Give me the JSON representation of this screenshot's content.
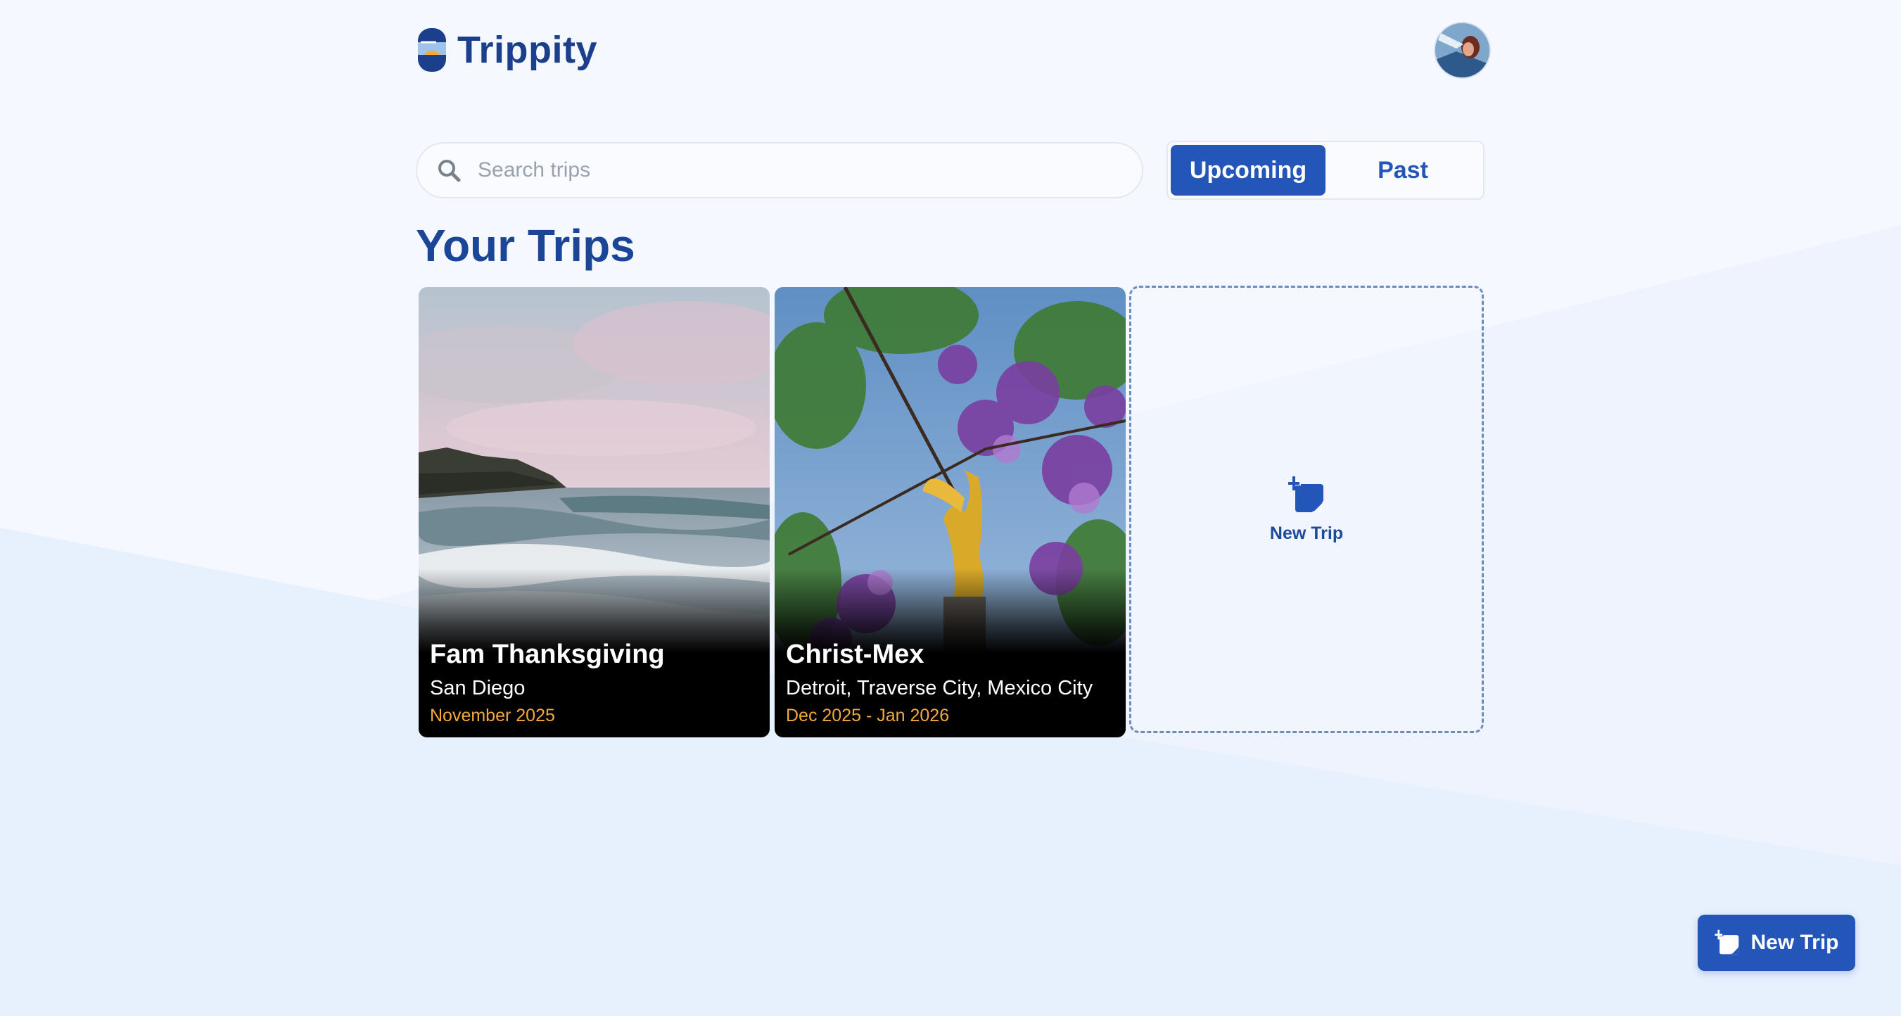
{
  "app": {
    "name": "Trippity"
  },
  "search": {
    "placeholder": "Search trips"
  },
  "filter": {
    "options": [
      "Upcoming",
      "Past"
    ],
    "selected": "Upcoming"
  },
  "page_title": "Your Trips",
  "trips": [
    {
      "name": "Fam Thanksgiving",
      "places": "San Diego",
      "dates": "November 2025",
      "image": "coastline-waves-photo"
    },
    {
      "name": "Christ-Mex",
      "places": "Detroit, Traverse City, Mexico City",
      "dates": "Dec 2025 - Jan 2026",
      "image": "angel-statue-jacaranda-photo"
    }
  ],
  "new_trip_card": {
    "label": "New Trip",
    "icon": "add-note-icon"
  },
  "fab": {
    "label": "New Trip",
    "icon": "add-note-icon"
  },
  "colors": {
    "primary": "#2356b8",
    "title": "#1b4597",
    "date_accent": "#f6a93b",
    "background": "#f5f9ff"
  }
}
